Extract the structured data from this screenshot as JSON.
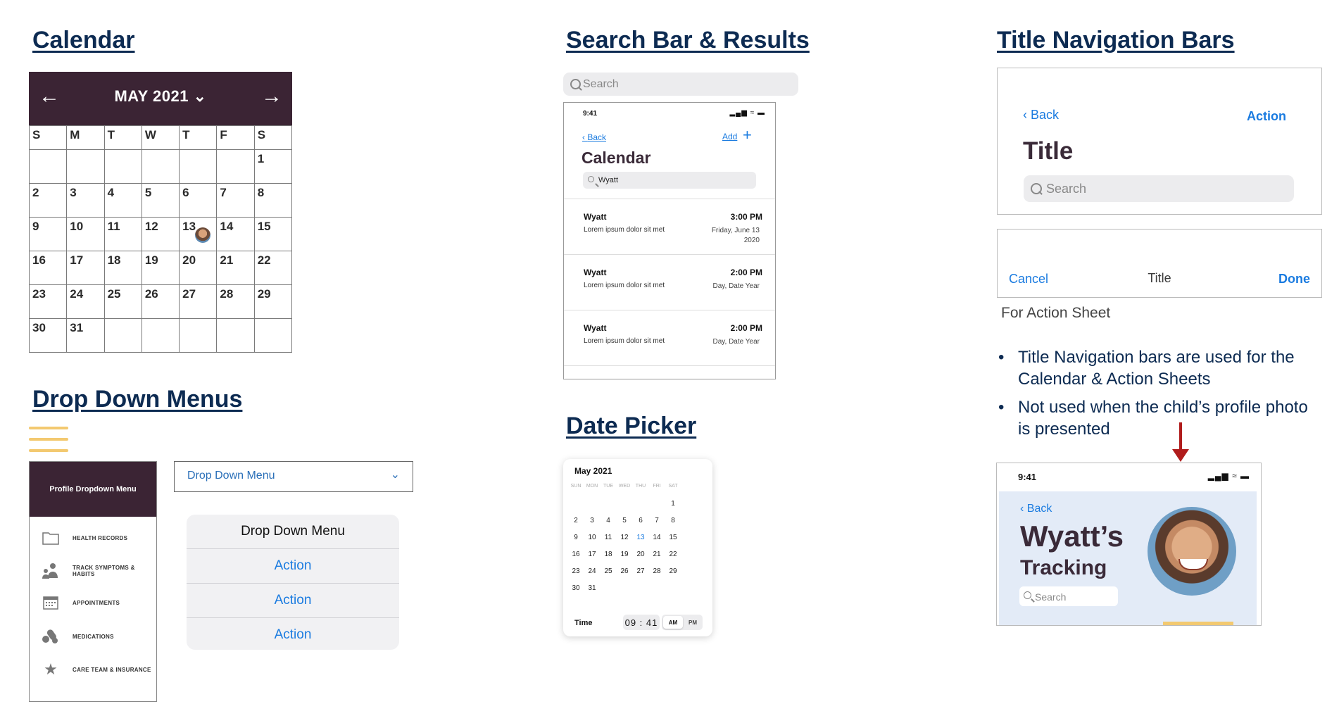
{
  "headings": {
    "calendar": "Calendar",
    "search": "Search Bar & Results",
    "navbars": "Title Navigation Bars",
    "dropdowns": "Drop Down Menus",
    "datepicker": "Date Picker"
  },
  "calendar": {
    "month_label": "MAY 2021 ⌄",
    "prev_icon": "arrow-left-icon",
    "next_icon": "arrow-right-icon",
    "weekdays": [
      "S",
      "M",
      "T",
      "W",
      "T",
      "F",
      "S"
    ],
    "weeks": [
      [
        "",
        "",
        "",
        "",
        "",
        "",
        "1"
      ],
      [
        "2",
        "3",
        "4",
        "5",
        "6",
        "7",
        "8"
      ],
      [
        "9",
        "10",
        "11",
        "12",
        "13",
        "14",
        "15"
      ],
      [
        "16",
        "17",
        "18",
        "19",
        "20",
        "21",
        "22"
      ],
      [
        "23",
        "24",
        "25",
        "26",
        "27",
        "28",
        "29"
      ],
      [
        "30",
        "31",
        "",
        "",
        "",
        "",
        ""
      ]
    ],
    "header_color": "#3b2434"
  },
  "dropdowns": {
    "profile_menu": {
      "title": "Profile Dropdown Menu",
      "items": [
        {
          "label": "HEALTH RECORDS",
          "icon": "folder-icon"
        },
        {
          "label": "TRACK SYMPTOMS & HABITS",
          "icon": "people-icon"
        },
        {
          "label": "APPOINTMENTS",
          "icon": "calendar-icon"
        },
        {
          "label": "MEDICATIONS",
          "icon": "pills-icon"
        },
        {
          "label": "CARE TEAM & INSURANCE",
          "icon": "star-icon"
        }
      ]
    },
    "select": {
      "label": "Drop Down Menu"
    },
    "sheet": {
      "title": "Drop Down Menu",
      "actions": [
        "Action",
        "Action",
        "Action"
      ]
    }
  },
  "search": {
    "placeholder": "Search",
    "phone": {
      "time": "9:41",
      "status": "▂▄▆ ≈ ▬",
      "back": "Back",
      "add": "Add",
      "title": "Calendar",
      "query": "Wyatt",
      "results": [
        {
          "name": "Wyatt",
          "desc": "Lorem ipsum dolor sit met",
          "time": "3:00 PM",
          "date": "Friday, June 13 2020"
        },
        {
          "name": "Wyatt",
          "desc": "Lorem ipsum dolor sit met",
          "time": "2:00 PM",
          "date": "Day, Date Year"
        },
        {
          "name": "Wyatt",
          "desc": "Lorem ipsum dolor sit met",
          "time": "2:00 PM",
          "date": "Day, Date Year"
        }
      ]
    }
  },
  "datepicker": {
    "month": "May 2021",
    "dow": [
      "SUN",
      "MON",
      "TUE",
      "WED",
      "THU",
      "FRI",
      "SAT"
    ],
    "weeks": [
      [
        "",
        "",
        "",
        "",
        "",
        "",
        "1"
      ],
      [
        "2",
        "3",
        "4",
        "5",
        "6",
        "7",
        "8"
      ],
      [
        "9",
        "10",
        "11",
        "12",
        "13",
        "14",
        "15"
      ],
      [
        "16",
        "17",
        "18",
        "19",
        "20",
        "21",
        "22"
      ],
      [
        "23",
        "24",
        "25",
        "26",
        "27",
        "28",
        "29"
      ],
      [
        "30",
        "31",
        "",
        "",
        "",
        "",
        ""
      ]
    ],
    "selected_day": "13",
    "time_label": "Time",
    "time_value": "09 : 41",
    "am": "AM",
    "pm": "PM"
  },
  "navbars": {
    "large": {
      "back": "Back",
      "action": "Action",
      "title": "Title",
      "search_placeholder": "Search"
    },
    "sheet": {
      "cancel": "Cancel",
      "title": "Title",
      "done": "Done"
    },
    "caption": "For Action Sheet",
    "bullets": [
      "Title Navigation bars are used for the Calendar & Action Sheets",
      "Not used when the child’s profile photo is presented"
    ],
    "profile_phone": {
      "time": "9:41",
      "status": "▂▄▆ ≈ ▬",
      "back": "Back",
      "name": "Wyatt’s",
      "subtitle": "Tracking",
      "search_placeholder": "Search"
    }
  },
  "colors": {
    "heading": "#0d2b52",
    "accent": "#1a7be0",
    "plum": "#3b2434",
    "arrow": "#b01c1c"
  }
}
